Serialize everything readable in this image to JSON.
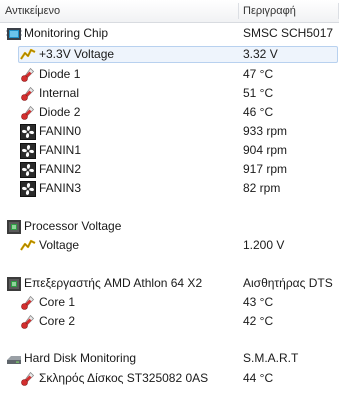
{
  "header": {
    "name_col": "Αντικείμενο",
    "desc_col": "Περιγραφή"
  },
  "rows": [
    {
      "label": "Monitoring Chip",
      "value": "SMSC SCH5017",
      "icon": "chip-icon"
    },
    {
      "label": "+3.3V Voltage",
      "value": "3.32 V",
      "icon": "voltage-icon"
    },
    {
      "label": "Diode 1",
      "value": "47 °C",
      "icon": "thermometer-icon"
    },
    {
      "label": "Internal",
      "value": "51 °C",
      "icon": "thermometer-icon"
    },
    {
      "label": "Diode 2",
      "value": "46 °C",
      "icon": "thermometer-icon"
    },
    {
      "label": "FANIN0",
      "value": "933 rpm",
      "icon": "fan-icon"
    },
    {
      "label": "FANIN1",
      "value": "904 rpm",
      "icon": "fan-icon"
    },
    {
      "label": "FANIN2",
      "value": "917 rpm",
      "icon": "fan-icon"
    },
    {
      "label": "FANIN3",
      "value": "82 rpm",
      "icon": "fan-icon"
    },
    {
      "label": "Processor Voltage",
      "value": "",
      "icon": "processor-icon"
    },
    {
      "label": "Voltage",
      "value": "1.200 V",
      "icon": "voltage-icon"
    },
    {
      "label": "Επεξεργαστής AMD Athlon 64 X2",
      "value": "Αισθητήρας DTS",
      "icon": "processor-icon"
    },
    {
      "label": "Core 1",
      "value": "43 °C",
      "icon": "thermometer-icon"
    },
    {
      "label": "Core 2",
      "value": "42 °C",
      "icon": "thermometer-icon"
    },
    {
      "label": "Hard Disk Monitoring",
      "value": "S.M.A.R.T",
      "icon": "hard-disk-icon"
    },
    {
      "label": "Σκληρός Δίσκος ST325082 0AS",
      "value": "44 °C",
      "icon": "thermometer-icon"
    }
  ],
  "colors": {
    "selection_fill": "#eef4fc",
    "selection_border": "#b8d1ef",
    "thermometer_red": "#c0392b",
    "voltage_yellow": "#d8a800"
  }
}
